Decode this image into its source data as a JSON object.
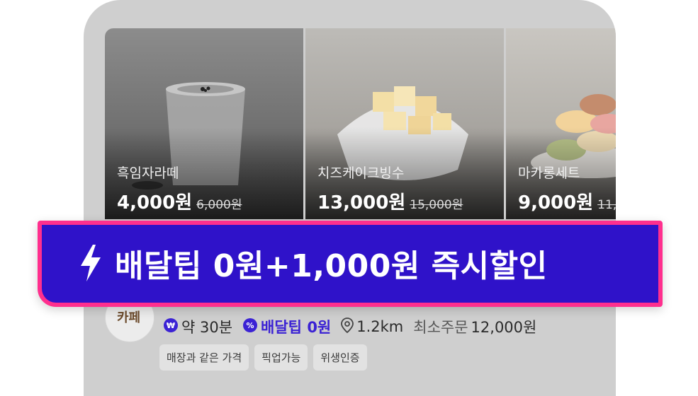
{
  "menu_items": [
    {
      "name": "흑임자라떼",
      "price": "4,000원",
      "original_price": "6,000원"
    },
    {
      "name": "치즈케이크빙수",
      "price": "13,000원",
      "original_price": "15,000원"
    },
    {
      "name": "마카롱세트",
      "price": "9,000원",
      "original_price": "11,"
    }
  ],
  "banner": {
    "icon": "lightning-bolt-icon",
    "text": "배달팁 0원+1,000원 즉시할인"
  },
  "store": {
    "logo_text": "카페",
    "delivery_time": "약 30분",
    "delivery_tip": "배달팁 0원",
    "distance": "1.2km",
    "min_order_label": "최소주문",
    "min_order_value": "12,000원",
    "tags": [
      "매장과 같은 가격",
      "픽업가능",
      "위생인증"
    ]
  },
  "colors": {
    "banner_bg": "#2f12c9",
    "banner_border": "#ff2f8e",
    "accent": "#3b22d4"
  }
}
